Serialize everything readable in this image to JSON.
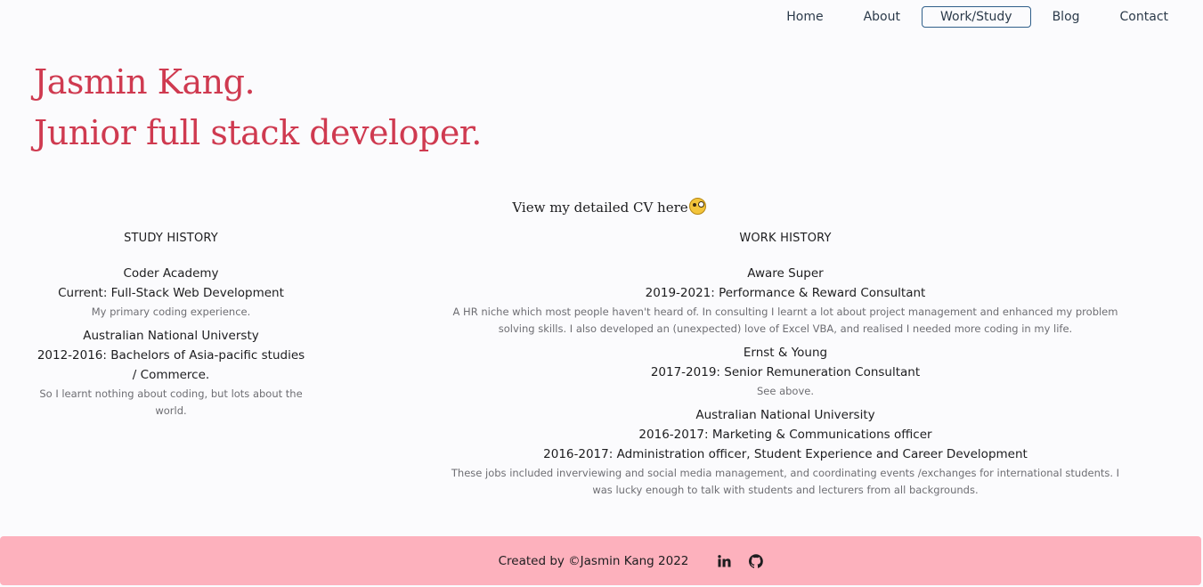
{
  "nav": {
    "items": [
      {
        "label": "Home",
        "active": false
      },
      {
        "label": "About",
        "active": false
      },
      {
        "label": "Work/Study",
        "active": true
      },
      {
        "label": "Blog",
        "active": false
      },
      {
        "label": "Contact",
        "active": false
      }
    ]
  },
  "hero": {
    "name": "Jasmin Kang.",
    "tagline": "Junior full stack developer."
  },
  "cv": {
    "link_text": "View my detailed CV here",
    "emoji_icon": "monocle-face-icon"
  },
  "study": {
    "heading": "STUDY HISTORY",
    "entries": [
      {
        "org": "Coder Academy",
        "roles": [
          "Current: Full-Stack Web Development"
        ],
        "desc": "My primary coding experience."
      },
      {
        "org": "Australian National Universty",
        "roles": [
          "2012-2016: Bachelors of Asia-pacific studies / Commerce."
        ],
        "desc": "So I learnt nothing about coding, but lots about the world."
      }
    ]
  },
  "work": {
    "heading": "WORK HISTORY",
    "entries": [
      {
        "org": "Aware Super",
        "roles": [
          "2019-2021: Performance & Reward Consultant"
        ],
        "desc": "A HR niche which most people haven't heard of. In consulting I learnt a lot about project management and enhanced my problem solving skills. I also developed an (unexpected) love of Excel VBA, and realised I needed more coding in my life."
      },
      {
        "org": "Ernst & Young",
        "roles": [
          "2017-2019: Senior Remuneration Consultant"
        ],
        "desc": "See above."
      },
      {
        "org": "Australian National University",
        "roles": [
          "2016-2017: Marketing & Communications officer",
          "2016-2017: Administration officer, Student Experience and Career Development"
        ],
        "desc": "These jobs included inverviewing and social media management, and coordinating events /exchanges for international students. I was lucky enough to talk with students and lecturers from all backgrounds."
      }
    ]
  },
  "footer": {
    "credit": "Created by ©Jasmin Kang 2022",
    "icons": [
      "linkedin-icon",
      "github-icon"
    ],
    "background": "#fdb1bd"
  },
  "colors": {
    "accent": "#cf3a50",
    "nav_active_border": "#2f5f8a",
    "muted_text": "#6e6e73"
  }
}
